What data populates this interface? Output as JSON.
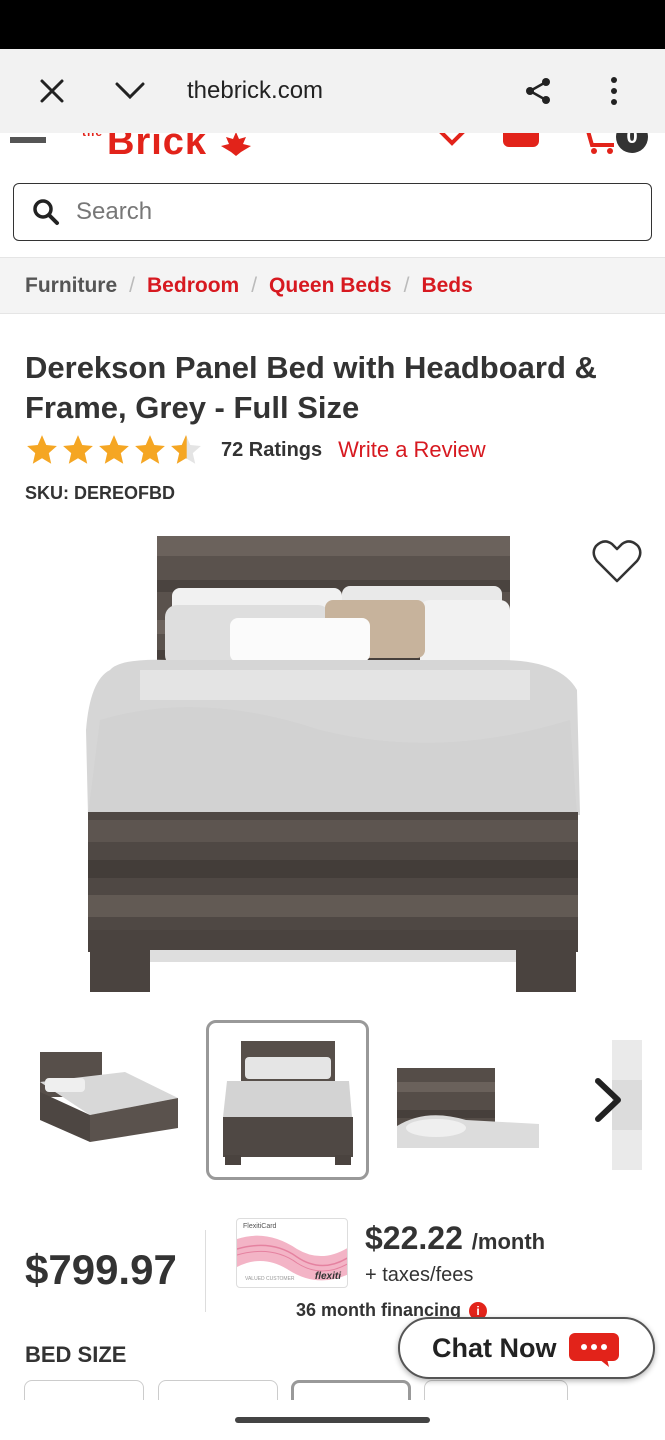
{
  "browser": {
    "url": "thebrick.com",
    "close_icon": "close-icon",
    "expand_icon": "chevron-down-icon",
    "share_icon": "share-icon",
    "menu_icon": "more-vert-icon"
  },
  "header": {
    "logo_small": "the",
    "logo_text": "Brick",
    "cart_count": "0",
    "colors": {
      "brand": "#e2231a"
    }
  },
  "search": {
    "placeholder": "Search"
  },
  "breadcrumb": {
    "items": [
      "Furniture",
      "Bedroom",
      "Queen Beds",
      "Beds"
    ],
    "separator": "/"
  },
  "product": {
    "title": "Derekson Panel Bed with Headboard & Frame, Grey - Full Size",
    "rating": 4.5,
    "ratings_count_label": "72 Ratings",
    "write_review_label": "Write a Review",
    "sku_label": "SKU: DEREOFBD",
    "price": "$799.97"
  },
  "financing": {
    "card_label": "FlexitiCard",
    "card_brand": "flexiti",
    "card_name": "VALUED CUSTOMER",
    "monthly": "$22.22",
    "per_month": "/month",
    "taxes": "+ taxes/fees",
    "term": "36 month financing"
  },
  "options": {
    "bed_size_label": "BED SIZE"
  },
  "chat": {
    "label": "Chat Now"
  }
}
